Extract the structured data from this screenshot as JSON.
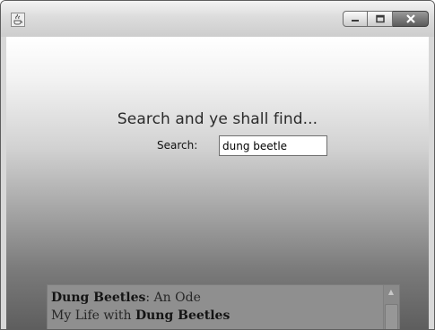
{
  "window": {
    "icon": "java-cup-icon",
    "buttons": [
      "minimize-icon",
      "maximize-icon",
      "close-icon"
    ]
  },
  "main": {
    "heading": "Search and ye shall find...",
    "search_label": "Search:",
    "search_value": "dung beetle"
  },
  "results": [
    {
      "bold": "Dung Beetles",
      "rest": ": An Ode"
    },
    {
      "prefix": "My Life with ",
      "bold": "Dung Beetles"
    }
  ]
}
